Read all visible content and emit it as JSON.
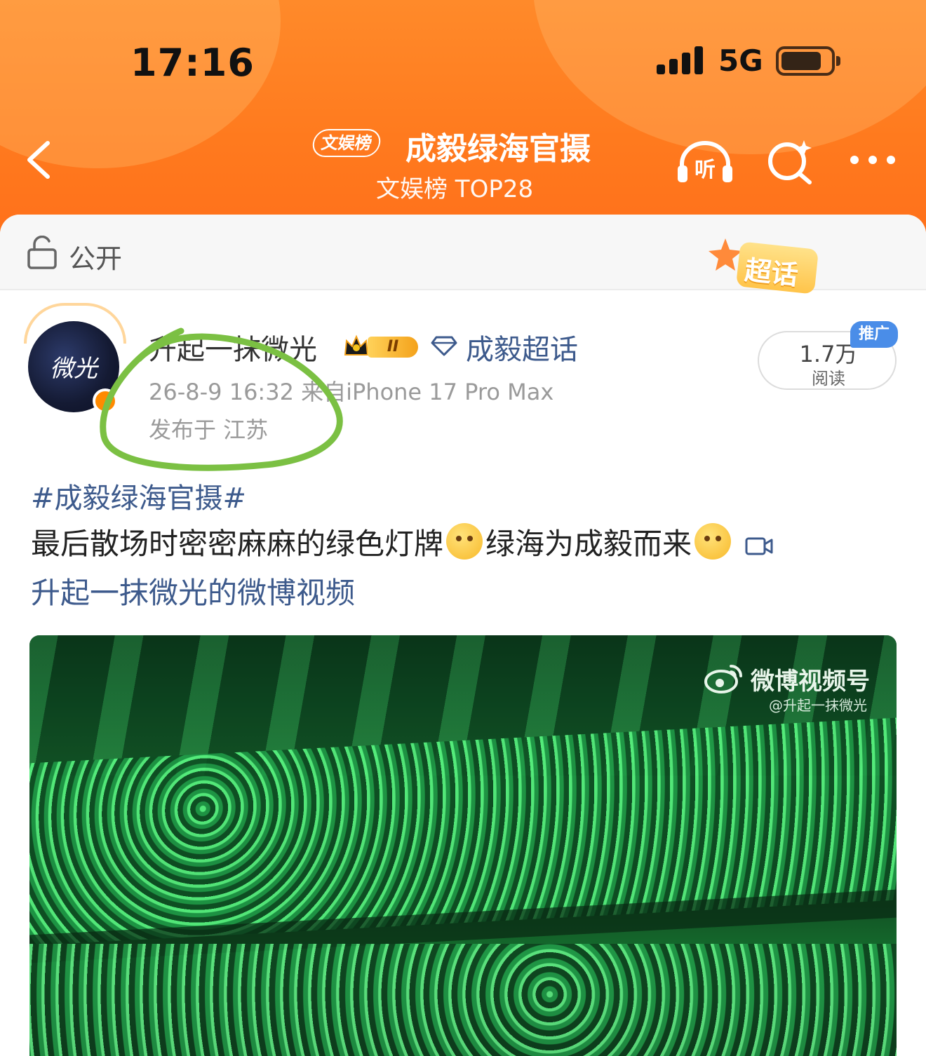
{
  "status_bar": {
    "time": "17:16",
    "network": "5G"
  },
  "nav": {
    "badge": "文娱榜",
    "title": "成毅绿海官摄",
    "subtitle": "文娱榜 TOP28",
    "listen_label": "听"
  },
  "privacy": {
    "label": "公开"
  },
  "topic_sticker": {
    "label": "超话"
  },
  "post": {
    "avatar_text": "微光",
    "username": "升起一抹微光",
    "level_badge": "II",
    "super_topic": "成毅超话",
    "meta": "26-8-9 16:32  来自iPhone 17 Pro Max",
    "location": "发布于 江苏",
    "reads": "1.7万",
    "reads_label": "阅读",
    "promo_tag": "推广",
    "hashtag": "#成毅绿海官摄#",
    "body_part1": "最后散场时密密麻麻的绿色灯牌",
    "body_part2": "绿海为成毅而来",
    "video_link": "升起一抹微光的微博视频"
  },
  "video": {
    "watermark_title": "微博视频号",
    "watermark_handle": "@升起一抹微光"
  },
  "colors": {
    "header": "#ff7a1e",
    "link": "#3d5a8c",
    "annotation": "#7bc043",
    "promo": "#4a8de8"
  },
  "icons": [
    "back-icon",
    "headphones-icon",
    "search-icon",
    "more-icon",
    "lock-icon",
    "diamond-icon",
    "video-icon",
    "weibo-logo-icon"
  ]
}
